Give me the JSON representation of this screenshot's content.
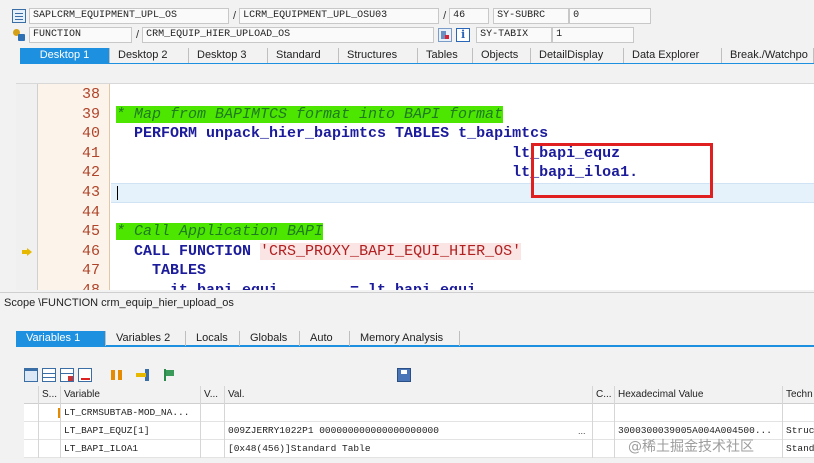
{
  "header": {
    "row1": {
      "program": "SAPLCRM_EQUIPMENT_UPL_OS",
      "include": "LCRM_EQUIPMENT_UPL_OSU03",
      "line": "46",
      "sysfield": "SY-SUBRC",
      "sysvalue": "0",
      "sep": "/"
    },
    "row2": {
      "type": "FUNCTION",
      "name": "CRM_EQUIP_HIER_UPLOAD_OS",
      "sysfield": "SY-TABIX",
      "sysvalue": "1",
      "sep": "/"
    }
  },
  "tabs": [
    {
      "label": "Desktop 1",
      "active": true
    },
    {
      "label": "Desktop 2"
    },
    {
      "label": "Desktop 3"
    },
    {
      "label": "Standard"
    },
    {
      "label": "Structures"
    },
    {
      "label": "Tables"
    },
    {
      "label": "Objects"
    },
    {
      "label": "DetailDisplay"
    },
    {
      "label": "Data Explorer"
    },
    {
      "label": "Break./Watchpo"
    }
  ],
  "code": {
    "lines": [
      {
        "num": "38",
        "parts": []
      },
      {
        "num": "39",
        "parts": [
          {
            "t": "* Map from BAPIMTCS format into BAPI format",
            "c": "cmt"
          }
        ]
      },
      {
        "num": "40",
        "parts": [
          {
            "t": "  ",
            "c": ""
          },
          {
            "t": "PERFORM unpack_hier_bapimtcs TABLES t_bapimtcs",
            "c": "kw"
          }
        ]
      },
      {
        "num": "41",
        "parts": [
          {
            "t": "                                            ",
            "c": ""
          },
          {
            "t": "lt_bapi_equz",
            "c": "kw"
          }
        ]
      },
      {
        "num": "42",
        "parts": [
          {
            "t": "                                            ",
            "c": ""
          },
          {
            "t": "lt_bapi_iloa1.",
            "c": "kw"
          }
        ]
      },
      {
        "num": "43",
        "parts": [],
        "cursor": true
      },
      {
        "num": "44",
        "parts": []
      },
      {
        "num": "45",
        "parts": [
          {
            "t": "* Call Application BAPI",
            "c": "cmt"
          }
        ]
      },
      {
        "num": "46",
        "parts": [
          {
            "t": "  ",
            "c": ""
          },
          {
            "t": "CALL FUNCTION ",
            "c": "kw"
          },
          {
            "t": "'CRS_PROXY_BAPI_EQUI_HIER_OS'",
            "c": "str"
          }
        ],
        "current": true
      },
      {
        "num": "47",
        "parts": [
          {
            "t": "    ",
            "c": ""
          },
          {
            "t": "TABLES",
            "c": "kw"
          }
        ]
      },
      {
        "num": "48",
        "parts": [
          {
            "t": "      ",
            "c": ""
          },
          {
            "t": "it_bapi_equi        = lt_bapi_equi",
            "c": "kw"
          }
        ]
      }
    ]
  },
  "scope": "Scope \\FUNCTION crm_equip_hier_upload_os",
  "var_tabs": [
    {
      "label": "Variables 1",
      "active": true
    },
    {
      "label": "Variables 2"
    },
    {
      "label": "Locals"
    },
    {
      "label": "Globals"
    },
    {
      "label": "Auto"
    },
    {
      "label": "Memory Analysis"
    }
  ],
  "toolbar_icons": [
    "trash-icon",
    "table-icon",
    "table-refresh-icon",
    "delete-row-icon",
    "sort-icon",
    "move-icon",
    "flag-icon",
    "save-icon"
  ],
  "table": {
    "headers": {
      "s": "S...",
      "var": "Variable",
      "v": "V...",
      "val": "Val.",
      "c": "C...",
      "hex": "Hexadecimal Value",
      "tech": "Techn"
    },
    "rows": [
      {
        "var": "LT_CRMSUBTAB-MOD_NA...",
        "val": "",
        "hex": "",
        "tech": "",
        "icon": true
      },
      {
        "var": "LT_BAPI_EQUZ[1]",
        "val": "009ZJERRY1022P1        000000000000000000000",
        "hex": "3000300039005A004A004500...",
        "tech": "Struct",
        "ellipsis": "..."
      },
      {
        "var": "LT_BAPI_ILOA1",
        "val": "[0x48(456)]Standard Table",
        "hex": "",
        "tech": "Standa"
      }
    ]
  },
  "watermark": "@稀土掘金技术社区"
}
